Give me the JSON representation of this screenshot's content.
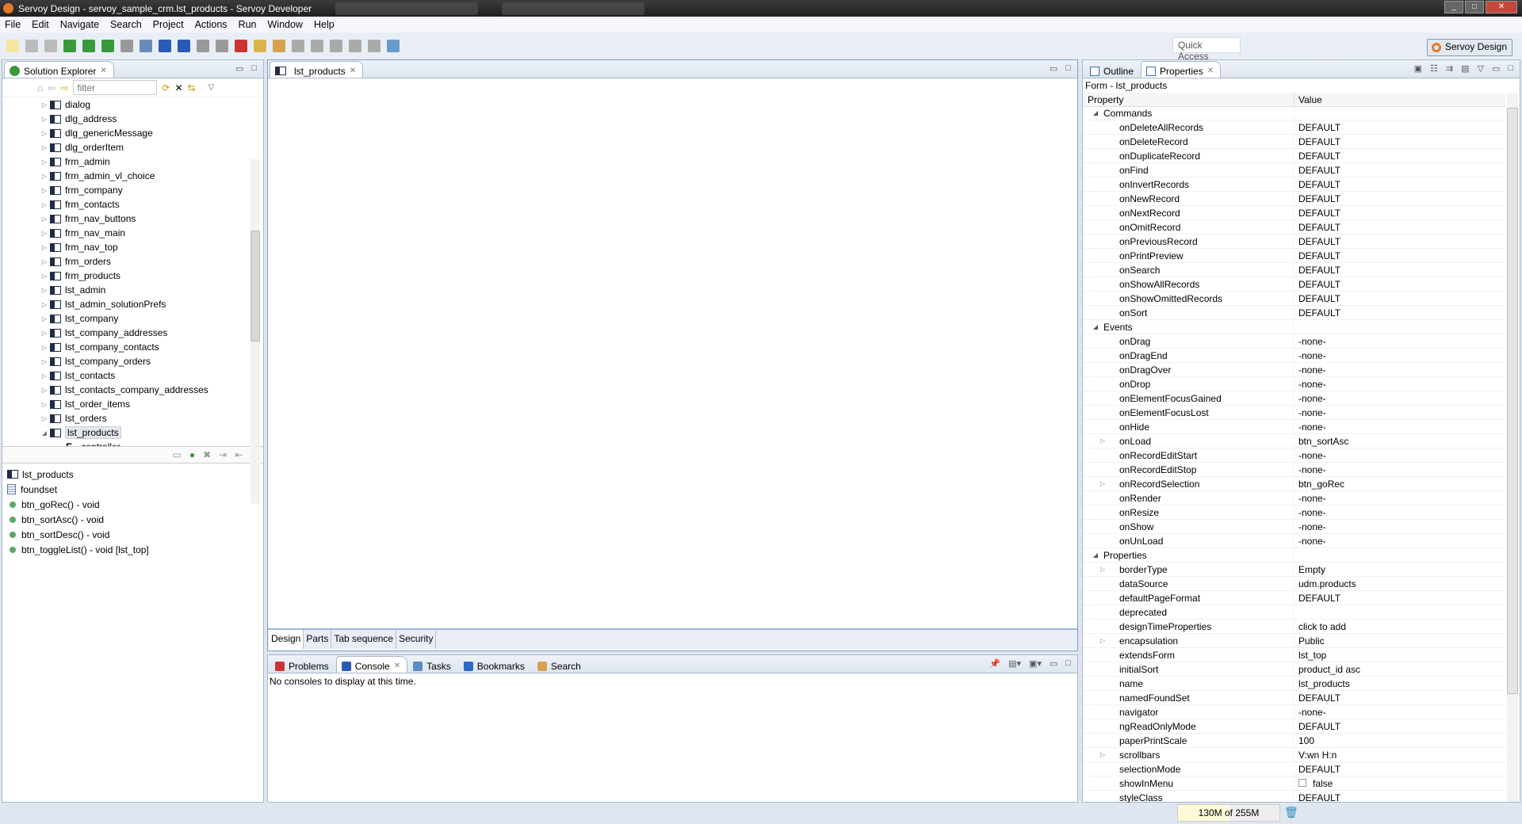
{
  "window": {
    "title": "Servoy Design - servoy_sample_crm.lst_products - Servoy Developer"
  },
  "menu": [
    "File",
    "Edit",
    "Navigate",
    "Search",
    "Project",
    "Actions",
    "Run",
    "Window",
    "Help"
  ],
  "toolbar": {
    "quick_access": "Quick Access",
    "perspective": "Servoy Design"
  },
  "solution_explorer": {
    "tab": "Solution Explorer",
    "filter_placeholder": "filter",
    "tree": [
      "dialog",
      "dlg_address",
      "dlg_genericMessage",
      "dlg_orderItem",
      "frm_admin",
      "frm_admin_vl_choice",
      "frm_company",
      "frm_contacts",
      "frm_nav_buttons",
      "frm_nav_main",
      "frm_nav_top",
      "frm_orders",
      "frm_products",
      "lst_admin",
      "lst_admin_solutionPrefs",
      "lst_company",
      "lst_company_addresses",
      "lst_company_contacts",
      "lst_company_orders",
      "lst_contacts",
      "lst_contacts_company_addresses",
      "lst_order_items",
      "lst_orders",
      "lst_products"
    ],
    "selected": "lst_products",
    "child": "controller",
    "outline": [
      {
        "label": "lst_products",
        "icon": "form-icon"
      },
      {
        "label": "foundset",
        "icon": "foundset-icon"
      },
      {
        "label": "btn_goRec() - void",
        "icon": "method-icon"
      },
      {
        "label": "btn_sortAsc() - void",
        "icon": "method-icon"
      },
      {
        "label": "btn_sortDesc() - void",
        "icon": "method-icon"
      },
      {
        "label": "btn_toggleList() - void [lst_top]",
        "icon": "method-icon"
      }
    ]
  },
  "editor": {
    "tab": "lst_products",
    "bottom_tabs": [
      "Design",
      "Parts",
      "Tab sequence",
      "Security"
    ],
    "active_bottom_tab": "Design"
  },
  "console": {
    "tabs": [
      "Problems",
      "Console",
      "Tasks",
      "Bookmarks",
      "Search"
    ],
    "active": "Console",
    "message": "No consoles to display at this time."
  },
  "properties": {
    "tabs": [
      "Outline",
      "Properties"
    ],
    "active": "Properties",
    "form_label": "Form - lst_products",
    "headers": [
      "Property",
      "Value"
    ],
    "rows": [
      {
        "cat": true,
        "name": "Commands"
      },
      {
        "name": "onDeleteAllRecords",
        "value": "DEFAULT"
      },
      {
        "name": "onDeleteRecord",
        "value": "DEFAULT"
      },
      {
        "name": "onDuplicateRecord",
        "value": "DEFAULT"
      },
      {
        "name": "onFind",
        "value": "DEFAULT"
      },
      {
        "name": "onInvertRecords",
        "value": "DEFAULT"
      },
      {
        "name": "onNewRecord",
        "value": "DEFAULT"
      },
      {
        "name": "onNextRecord",
        "value": "DEFAULT"
      },
      {
        "name": "onOmitRecord",
        "value": "DEFAULT"
      },
      {
        "name": "onPreviousRecord",
        "value": "DEFAULT"
      },
      {
        "name": "onPrintPreview",
        "value": "DEFAULT"
      },
      {
        "name": "onSearch",
        "value": "DEFAULT"
      },
      {
        "name": "onShowAllRecords",
        "value": "DEFAULT"
      },
      {
        "name": "onShowOmittedRecords",
        "value": "DEFAULT"
      },
      {
        "name": "onSort",
        "value": "DEFAULT"
      },
      {
        "cat": true,
        "name": "Events"
      },
      {
        "name": "onDrag",
        "value": "-none-"
      },
      {
        "name": "onDragEnd",
        "value": "-none-"
      },
      {
        "name": "onDragOver",
        "value": "-none-"
      },
      {
        "name": "onDrop",
        "value": "-none-"
      },
      {
        "name": "onElementFocusGained",
        "value": "-none-"
      },
      {
        "name": "onElementFocusLost",
        "value": "-none-"
      },
      {
        "name": "onHide",
        "value": "-none-"
      },
      {
        "name": "onLoad",
        "value": "btn_sortAsc",
        "expand": true
      },
      {
        "name": "onRecordEditStart",
        "value": "-none-"
      },
      {
        "name": "onRecordEditStop",
        "value": "-none-"
      },
      {
        "name": "onRecordSelection",
        "value": "btn_goRec",
        "expand": true
      },
      {
        "name": "onRender",
        "value": "-none-"
      },
      {
        "name": "onResize",
        "value": "-none-"
      },
      {
        "name": "onShow",
        "value": "-none-"
      },
      {
        "name": "onUnLoad",
        "value": "-none-"
      },
      {
        "cat": true,
        "name": "Properties"
      },
      {
        "name": "borderType",
        "value": "Empty",
        "expand": true
      },
      {
        "name": "dataSource",
        "value": "udm.products"
      },
      {
        "name": "defaultPageFormat",
        "value": "DEFAULT"
      },
      {
        "name": "deprecated",
        "value": ""
      },
      {
        "name": "designTimeProperties",
        "value": "click to add"
      },
      {
        "name": "encapsulation",
        "value": "Public",
        "expand": true
      },
      {
        "name": "extendsForm",
        "value": "lst_top"
      },
      {
        "name": "initialSort",
        "value": "product_id asc"
      },
      {
        "name": "name",
        "value": "lst_products"
      },
      {
        "name": "namedFoundSet",
        "value": "DEFAULT"
      },
      {
        "name": "navigator",
        "value": "-none-"
      },
      {
        "name": "ngReadOnlyMode",
        "value": "DEFAULT"
      },
      {
        "name": "paperPrintScale",
        "value": "100"
      },
      {
        "name": "scrollbars",
        "value": "V:wn H:n",
        "expand": true
      },
      {
        "name": "selectionMode",
        "value": "DEFAULT"
      },
      {
        "name": "showInMenu",
        "value": "false",
        "checkbox": true
      },
      {
        "name": "styleClass",
        "value": "DEFAULT"
      }
    ]
  },
  "status": {
    "memory": "130M of 255M",
    "memory_used_fraction": 0.51
  }
}
